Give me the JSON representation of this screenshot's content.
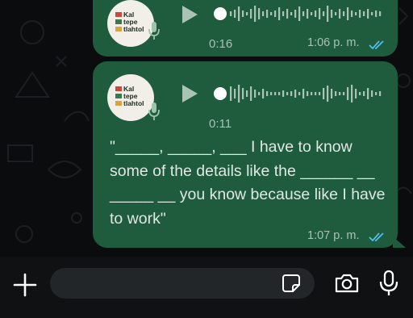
{
  "chat": {
    "messages": [
      {
        "type": "voice",
        "avatar_text": "Kal\ntepe\ntlahtol",
        "duration": "0:16",
        "time": "1:06 p. m.",
        "status": "read"
      },
      {
        "type": "voice",
        "avatar_text": "Kal\ntepe\ntlahtol",
        "duration": "0:11",
        "time": "1:07 p. m.",
        "status": "read",
        "transcript": "\"_____, _____, ___ I have to know some of the details like the ______ __ _____ __ you know because like I have to work\""
      }
    ]
  },
  "composer": {
    "placeholder": "",
    "value": ""
  },
  "icons": {
    "attach": "plus-icon",
    "sticker": "sticker-icon",
    "camera": "camera-icon",
    "voice": "microphone-icon"
  },
  "colors": {
    "bubble": "#1f5b3d",
    "read_ticks": "#53bdeb",
    "background": "#0b0c0d"
  }
}
